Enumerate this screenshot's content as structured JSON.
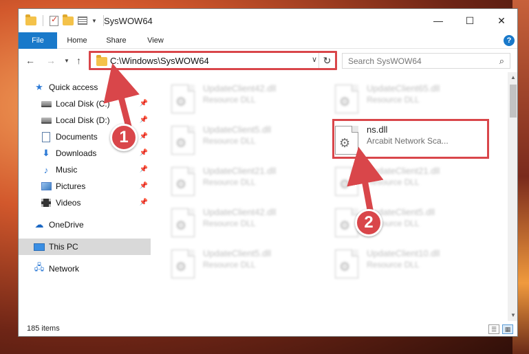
{
  "window": {
    "title": "SysWOW64",
    "controls": {
      "minimize": "—",
      "maximize": "☐",
      "close": "✕"
    }
  },
  "ribbon": {
    "tabs": [
      "File",
      "Home",
      "Share",
      "View"
    ],
    "help": "?"
  },
  "navigation": {
    "address": "C:\\Windows\\SysWOW64",
    "search_placeholder": "Search SysWOW64"
  },
  "sidebar": {
    "items": [
      {
        "label": "Quick access",
        "icon": "star-icon"
      },
      {
        "label": "Local Disk (C:)",
        "icon": "drive-icon"
      },
      {
        "label": "Local Disk (D:)",
        "icon": "drive-icon"
      },
      {
        "label": "Documents",
        "icon": "documents-icon"
      },
      {
        "label": "Downloads",
        "icon": "download-icon"
      },
      {
        "label": "Music",
        "icon": "music-icon"
      },
      {
        "label": "Pictures",
        "icon": "pictures-icon"
      },
      {
        "label": "Videos",
        "icon": "videos-icon"
      },
      {
        "label": "OneDrive",
        "icon": "cloud-icon"
      },
      {
        "label": "This PC",
        "icon": "computer-icon"
      },
      {
        "label": "Network",
        "icon": "network-icon"
      }
    ]
  },
  "files": [
    {
      "name": "UpdateClient42.dll",
      "desc": "Resource DLL"
    },
    {
      "name": "UpdateClient65.dll",
      "desc": "Resource DLL"
    },
    {
      "name": "UpdateClient5.dll",
      "desc": "Resource DLL"
    },
    {
      "name": "ns.dll",
      "desc": "Arcabit Network Sca..."
    },
    {
      "name": "UpdateClient21.dll",
      "desc": "Resource DLL"
    },
    {
      "name": "UpdateClient21.dll",
      "desc": "Resource DLL"
    },
    {
      "name": "UpdateClient42.dll",
      "desc": "Resource DLL"
    },
    {
      "name": "UpdateClient5.dll",
      "desc": "Resource DLL"
    },
    {
      "name": "UpdateClient5.dll",
      "desc": "Resource DLL"
    },
    {
      "name": "UpdateClient10.dll",
      "desc": "Resource DLL"
    }
  ],
  "status": {
    "item_count": "185 items"
  },
  "annotations": {
    "step1": "1",
    "step2": "2"
  },
  "colors": {
    "accent": "#1979ca",
    "highlight": "#d9464a",
    "selected_bg": "#d9d9d9"
  }
}
